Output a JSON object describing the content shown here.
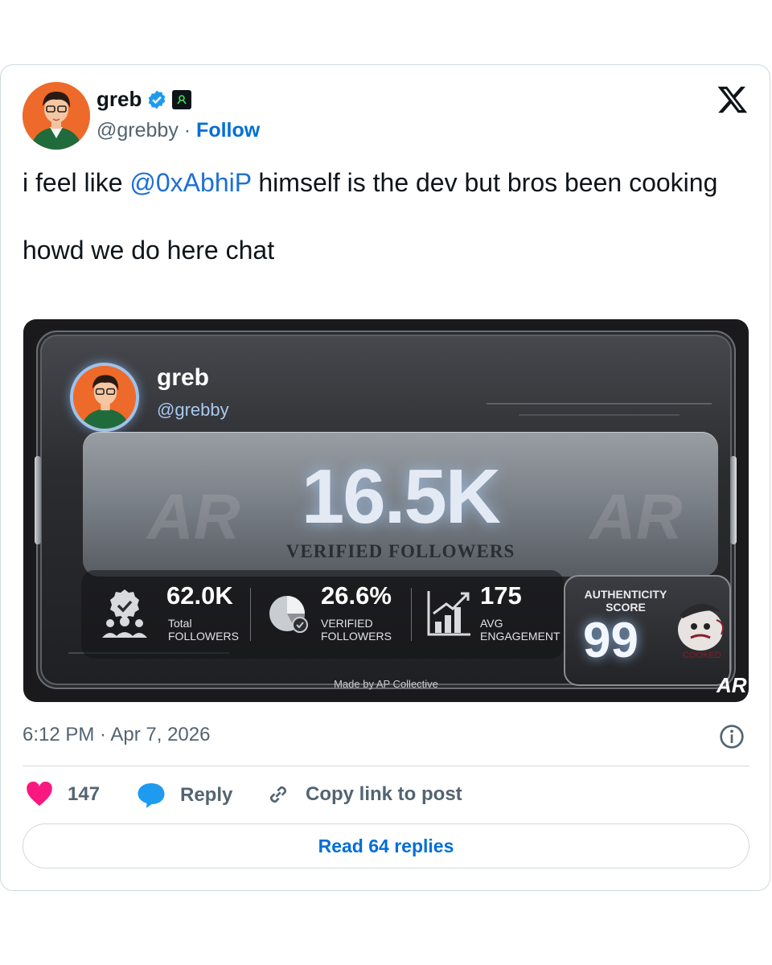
{
  "tweet": {
    "author": {
      "display_name": "greb",
      "handle": "@grebby",
      "follow_label": "Follow"
    },
    "text_before_mention": "i feel like ",
    "mention": "@0xAbhiP",
    "text_after_mention": " himself is the dev but bros been cooking",
    "text_line2": "howd we do here chat",
    "timestamp": "6:12 PM · Apr 7, 2026",
    "handle_separator": " · "
  },
  "media_card": {
    "name": "greb",
    "handle": "@grebby",
    "headline_value": "16.5K",
    "headline_label": "VERIFIED FOLLOWERS",
    "watermark": "AR",
    "stats": [
      {
        "value": "62.0K",
        "label_line1": "Total",
        "label_line2": "FOLLOWERS",
        "icon": "verified-people-icon"
      },
      {
        "value": "26.6%",
        "label_line1": "VERIFIED",
        "label_line2": "FOLLOWERS",
        "icon": "pie-chart-icon"
      },
      {
        "value": "175",
        "label_line1": "AVG",
        "label_line2": "ENGAGEMENT",
        "icon": "growth-chart-icon"
      }
    ],
    "authenticity": {
      "title_line1": "AUTHENTICITY",
      "title_line2": "SCORE",
      "score": "99",
      "badge_text": "COOKED"
    },
    "footer": "Made by AP Collective",
    "logo": "AR"
  },
  "actions": {
    "likes": "147",
    "reply_label": "Reply",
    "copy_label": "Copy link to post",
    "read_replies_label": "Read 64 replies"
  },
  "colors": {
    "link": "#006fd6",
    "like": "#f91880",
    "reply": "#1d9bf0",
    "muted": "#536471"
  }
}
